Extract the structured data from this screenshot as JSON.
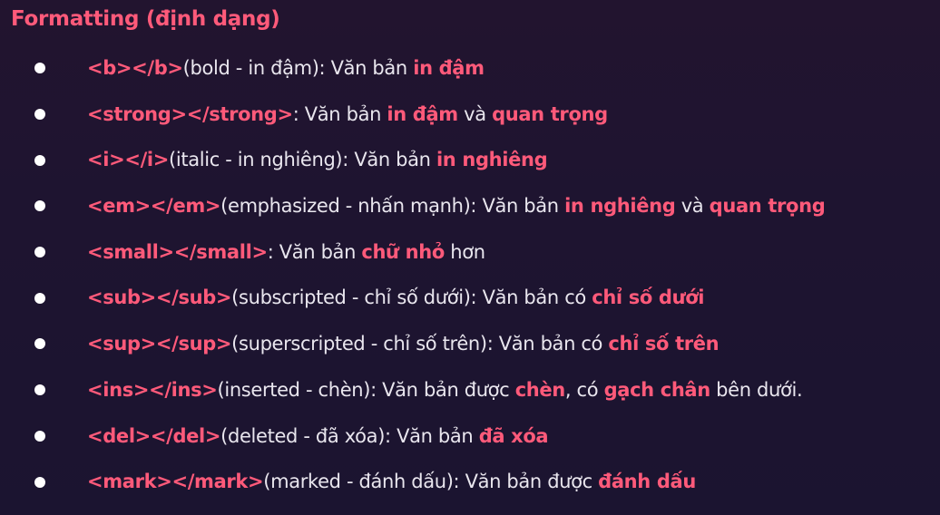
{
  "title": "Formatting (định dạng)",
  "items": [
    {
      "tag": "<b></b>",
      "parts": [
        {
          "t": "(bold - in đậm): Văn bản ",
          "h": false
        },
        {
          "t": "in đậm",
          "h": true
        }
      ]
    },
    {
      "tag": "<strong></strong>",
      "parts": [
        {
          "t": ": Văn bản ",
          "h": false
        },
        {
          "t": "in đậm",
          "h": true
        },
        {
          "t": " và ",
          "h": false
        },
        {
          "t": "quan trọng",
          "h": true
        }
      ]
    },
    {
      "tag": "<i></i>",
      "parts": [
        {
          "t": "(italic - in nghiêng): Văn bản ",
          "h": false
        },
        {
          "t": "in nghiêng",
          "h": true
        }
      ]
    },
    {
      "tag": "<em></em>",
      "parts": [
        {
          "t": "(emphasized - nhấn mạnh): Văn bản ",
          "h": false
        },
        {
          "t": "in nghiêng",
          "h": true
        },
        {
          "t": " và ",
          "h": false
        },
        {
          "t": "quan trọng",
          "h": true
        }
      ]
    },
    {
      "tag": "<small></small>",
      "parts": [
        {
          "t": ": Văn bản ",
          "h": false
        },
        {
          "t": "chữ nhỏ",
          "h": true
        },
        {
          "t": " hơn",
          "h": false
        }
      ]
    },
    {
      "tag": "<sub></sub>",
      "parts": [
        {
          "t": "(subscripted - chỉ số dưới): Văn bản có ",
          "h": false
        },
        {
          "t": "chỉ số dưới",
          "h": true
        }
      ]
    },
    {
      "tag": "<sup></sup>",
      "parts": [
        {
          "t": "(superscripted - chỉ số trên): Văn bản có ",
          "h": false
        },
        {
          "t": "chỉ số trên",
          "h": true
        }
      ]
    },
    {
      "tag": "<ins></ins>",
      "parts": [
        {
          "t": "(inserted - chèn): Văn bản được ",
          "h": false
        },
        {
          "t": "chèn",
          "h": true
        },
        {
          "t": ", có ",
          "h": false
        },
        {
          "t": "gạch chân",
          "h": true
        },
        {
          "t": " bên dưới.",
          "h": false
        }
      ]
    },
    {
      "tag": "<del></del>",
      "parts": [
        {
          "t": "(deleted - đã xóa): Văn bản ",
          "h": false
        },
        {
          "t": "đã xóa",
          "h": true
        }
      ]
    },
    {
      "tag": "<mark></mark>",
      "parts": [
        {
          "t": "(marked - đánh dấu): Văn bản được ",
          "h": false
        },
        {
          "t": "đánh dấu",
          "h": true
        }
      ]
    }
  ]
}
